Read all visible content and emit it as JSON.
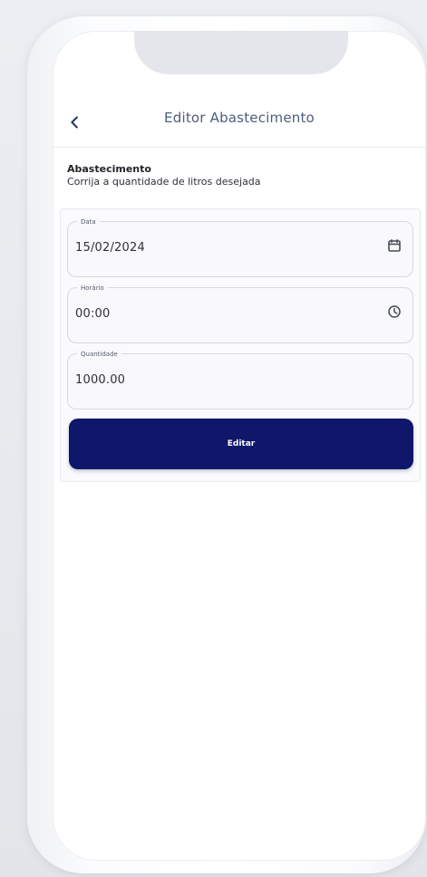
{
  "header": {
    "title": "Editor Abastecimento",
    "back_icon": "chevron-left-icon"
  },
  "section": {
    "title": "Abastecimento",
    "subtitle": "Corrija a quantidade de litros desejada"
  },
  "fields": {
    "date": {
      "label": "Data",
      "value": "15/02/2024",
      "icon": "calendar-icon"
    },
    "time": {
      "label": "Horário",
      "value": "00:00",
      "icon": "clock-icon"
    },
    "quantity": {
      "label": "Quantidade",
      "value": "1000.00"
    }
  },
  "actions": {
    "edit_label": "Editar"
  },
  "colors": {
    "primary_button": "#0F176A",
    "header_text": "#4F5C7B",
    "background": "#E6E8EE"
  }
}
